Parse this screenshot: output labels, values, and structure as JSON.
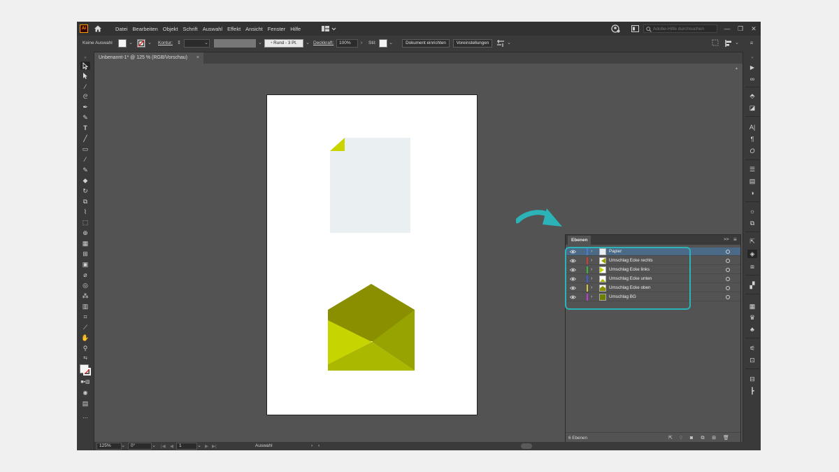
{
  "app": {
    "logo_text": "Ai",
    "menu": [
      "Datei",
      "Bearbeiten",
      "Objekt",
      "Schrift",
      "Auswahl",
      "Effekt",
      "Ansicht",
      "Fenster",
      "Hilfe"
    ],
    "search_placeholder": "Adobe-Hilfe durchsuchen",
    "window_buttons": [
      "—",
      "❐",
      "✕"
    ]
  },
  "controlbar": {
    "selection_label": "Keine Auswahl",
    "stroke_label": "Kontur:",
    "brush_label": "Rund - 3 Pt.",
    "opacity_label": "Deckkraft:",
    "opacity_value": "100%",
    "style_label": "Stil:",
    "doc_setup_button": "Dokument einrichten",
    "prefs_button": "Voreinstellungen"
  },
  "document_tab": {
    "title": "Unbenannt-1* @ 125 % (RGB/Vorschau)",
    "close": "×"
  },
  "statusbar": {
    "zoom": "125%",
    "rotation": "0°",
    "artboard_number": "1",
    "tool_name": "Auswahl"
  },
  "colors": {
    "paper": "#eaf0f1",
    "corner": "#c9d400",
    "env_top": "#8a8f00",
    "env_left": "#c6d400",
    "env_right": "#97a300",
    "env_bottom": "#aab800",
    "highlight": "#2bb3b7",
    "arrow": "#2bb3b7"
  },
  "layers_panel": {
    "tab_label": "Ebenen",
    "collapse_icon": ">>",
    "menu_icon": "≡",
    "footer_count": "6 Ebenen",
    "layers": [
      {
        "name": "Papier",
        "color": "#4a7bd6",
        "selected": true
      },
      {
        "name": "Umschlag Ecke rechts",
        "color": "#d23b3b",
        "selected": false
      },
      {
        "name": "Umschlag Ecke links",
        "color": "#3db53d",
        "selected": false
      },
      {
        "name": "Umschlag Ecke unten",
        "color": "#3b5fd6",
        "selected": false
      },
      {
        "name": "Umschlag Ecke oben",
        "color": "#d6c63b",
        "selected": false
      },
      {
        "name": "Umschlag BG",
        "color": "#c23bd6",
        "selected": false
      }
    ]
  }
}
